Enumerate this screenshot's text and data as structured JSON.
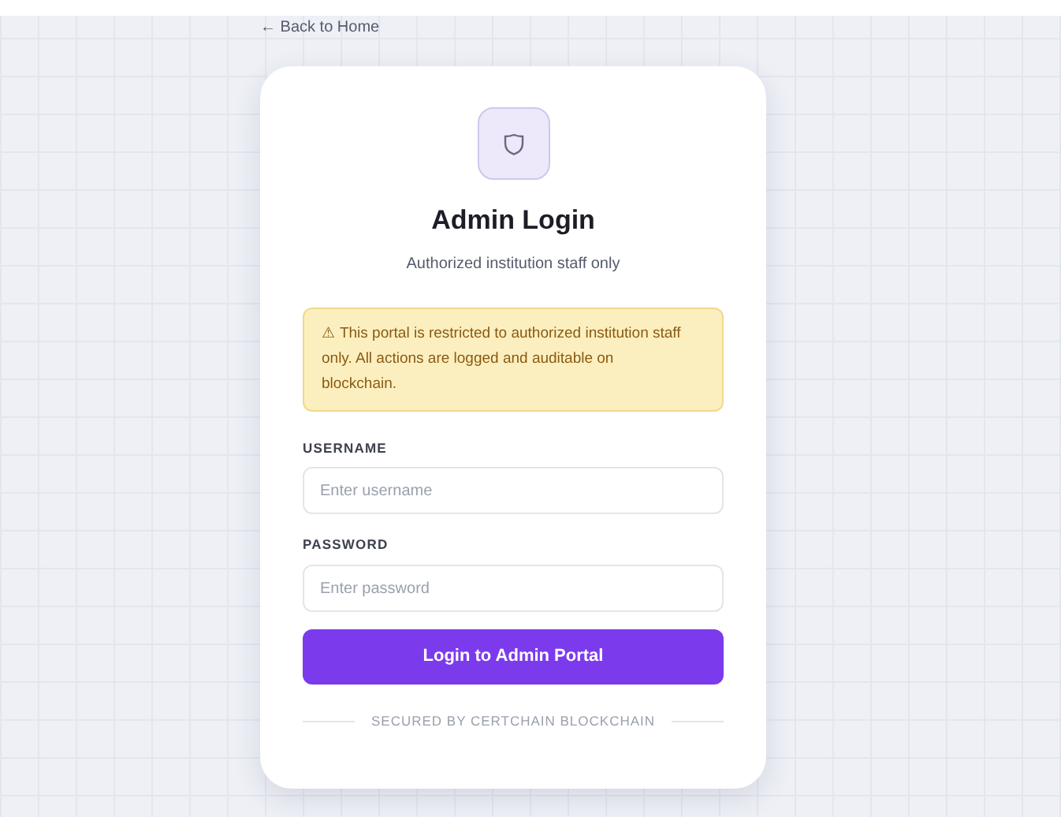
{
  "back_link": "← Back to Home",
  "card": {
    "title": "Admin Login",
    "subtitle": "Authorized institution staff only",
    "notice": "⚠ This portal is restricted to authorized institution staff only. All actions are logged and auditable on blockchain.",
    "fields": [
      {
        "label": "USERNAME",
        "placeholder": "Enter username"
      },
      {
        "label": "PASSWORD",
        "placeholder": "Enter password"
      }
    ],
    "submit": "Login to Admin Portal",
    "footer": "SECURED BY CERTCHAIN BLOCKCHAIN"
  }
}
